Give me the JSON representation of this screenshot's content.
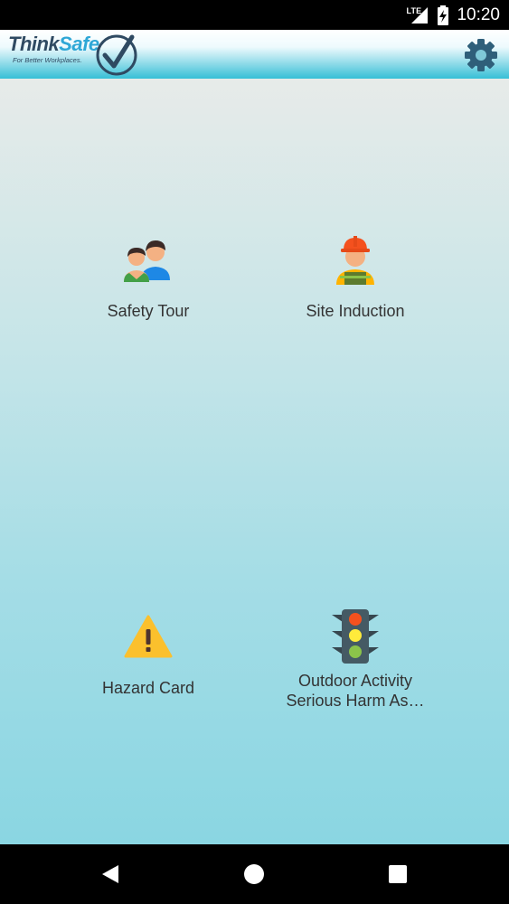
{
  "status_bar": {
    "network": "LTE",
    "time": "10:20"
  },
  "app_bar": {
    "logo": {
      "word_think": "Think",
      "word_safe": "Safe",
      "tagline": "For Better Workplaces."
    },
    "settings_icon": "gear-icon"
  },
  "tiles": [
    {
      "label": "Safety Tour",
      "icon": "people-icon"
    },
    {
      "label": "Site Induction",
      "icon": "worker-icon"
    },
    {
      "label": "Hazard Card",
      "icon": "warning-icon"
    },
    {
      "label": "Outdoor Activity\nSerious Harm As…",
      "icon": "traffic-light-icon"
    }
  ],
  "colors": {
    "app_bar_accent": "#37bfd6",
    "content_top": "#e7ebe9",
    "content_bottom": "#8ad6e2",
    "gear": "#2f5f7a",
    "warning": "#fbc02d"
  },
  "nav_bar": {
    "back_icon": "back-icon",
    "home_icon": "home-icon",
    "recents_icon": "recents-icon"
  }
}
